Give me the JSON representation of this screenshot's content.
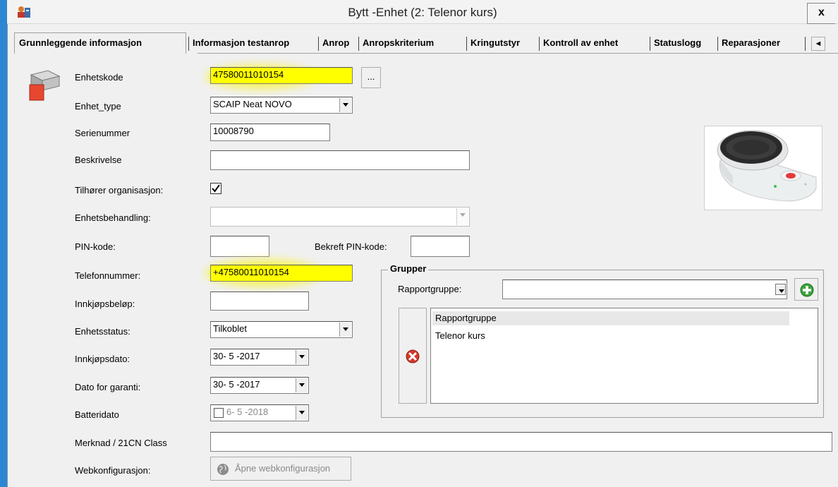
{
  "window": {
    "title": "Bytt -Enhet (2: Telenor kurs)",
    "close_label": "x"
  },
  "tabs": [
    {
      "label": "Grunnleggende informasjon"
    },
    {
      "label": "Informasjon testanrop"
    },
    {
      "label": "Anrop"
    },
    {
      "label": "Anropskriterium"
    },
    {
      "label": "Kringutstyr"
    },
    {
      "label": "Kontroll av enhet"
    },
    {
      "label": "Statuslogg"
    },
    {
      "label": "Reparasjoner"
    }
  ],
  "tab_scroll_label": "◄",
  "form": {
    "enhetskode": {
      "label": "Enhetskode",
      "value": "47580011010154",
      "browse_label": "..."
    },
    "enhet_type": {
      "label": "Enhet_type",
      "value": "SCAIP Neat NOVO"
    },
    "serienummer": {
      "label": "Serienummer",
      "value": "10008790"
    },
    "beskrivelse": {
      "label": "Beskrivelse",
      "value": ""
    },
    "tilhorer_org": {
      "label": "Tilhører organisasjon:",
      "checked": true
    },
    "enhetsbehandling": {
      "label": "Enhetsbehandling:",
      "value": ""
    },
    "pin_kode": {
      "label": "PIN-kode:",
      "value": ""
    },
    "bekreft_pin": {
      "label": "Bekreft PIN-kode:",
      "value": ""
    },
    "telefonnummer": {
      "label": "Telefonnummer:",
      "value": "+47580011010154"
    },
    "innkjopsbelop": {
      "label": "Innkjøpsbeløp:",
      "value": ""
    },
    "enhetsstatus": {
      "label": "Enhetsstatus:",
      "value": "Tilkoblet"
    },
    "innkjopsdato": {
      "label": "Innkjøpsdato:",
      "value": "30- 5 -2017"
    },
    "dato_garanti": {
      "label": "Dato for garanti:",
      "value": "30- 5 -2017"
    },
    "batteridato": {
      "label": "Batteridato",
      "value": "6- 5 -2018",
      "checked": false
    },
    "merknad": {
      "label": "Merknad / 21CN Class",
      "value": ""
    },
    "webkonfig": {
      "label": "Webkonfigurasjon:",
      "button_label": "Åpne webkonfigurasjon"
    }
  },
  "grupper": {
    "title": "Grupper",
    "rapportgruppe_label": "Rapportgruppe:",
    "rapportgruppe_value": "",
    "list_items": [
      "Rapportgruppe",
      "Telenor kurs"
    ]
  },
  "colors": {
    "highlight": "#ffff00",
    "desktop": "#2c86d2",
    "add_icon": "#3ca43c",
    "remove_icon": "#d23a2a"
  },
  "icons": [
    "device-icon",
    "add-icon",
    "remove-icon",
    "globe-icon",
    "dropdown-arrow-icon",
    "app-icon"
  ]
}
